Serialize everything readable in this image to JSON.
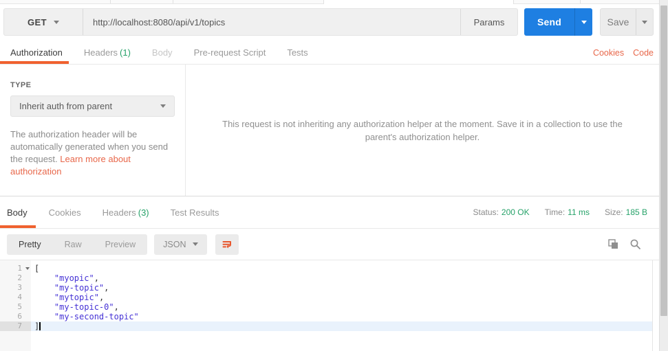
{
  "request": {
    "method": "GET",
    "url": "http://localhost:8080/api/v1/topics",
    "params_label": "Params",
    "send_label": "Send",
    "save_label": "Save",
    "tabs": [
      {
        "label": "Authorization"
      },
      {
        "label": "Headers",
        "count": "(1)"
      },
      {
        "label": "Body"
      },
      {
        "label": "Pre-request Script"
      },
      {
        "label": "Tests"
      }
    ],
    "cookies_link": "Cookies",
    "code_link": "Code"
  },
  "authorization": {
    "type_label": "TYPE",
    "type_value": "Inherit auth from parent",
    "help_text": "The authorization header will be automatically generated when you send the request. ",
    "help_link_label": "Learn more about authorization",
    "inherit_message": "This request is not inheriting any authorization helper at the moment. Save it in a collection to use the parent's authorization helper."
  },
  "response": {
    "tabs": [
      {
        "label": "Body"
      },
      {
        "label": "Cookies"
      },
      {
        "label": "Headers",
        "count": "(3)"
      },
      {
        "label": "Test Results"
      }
    ],
    "meta": {
      "status_label": "Status:",
      "status_value": "200 OK",
      "time_label": "Time:",
      "time_value": "11 ms",
      "size_label": "Size:",
      "size_value": "185 B"
    },
    "toolbar": {
      "modes": [
        {
          "label": "Pretty"
        },
        {
          "label": "Raw"
        },
        {
          "label": "Preview"
        }
      ],
      "format_value": "JSON"
    },
    "body_lines": [
      {
        "num": "1",
        "indent": "",
        "str": "",
        "punct": "["
      },
      {
        "num": "2",
        "indent": "    ",
        "str": "\"myopic\"",
        "punct": ","
      },
      {
        "num": "3",
        "indent": "    ",
        "str": "\"my-topic\"",
        "punct": ","
      },
      {
        "num": "4",
        "indent": "    ",
        "str": "\"mytopic\"",
        "punct": ","
      },
      {
        "num": "5",
        "indent": "    ",
        "str": "\"my-topic-0\"",
        "punct": ","
      },
      {
        "num": "6",
        "indent": "    ",
        "str": "\"my-second-topic\"",
        "punct": ""
      },
      {
        "num": "7",
        "indent": "",
        "str": "",
        "punct": "]"
      }
    ]
  },
  "colors": {
    "accent_orange": "#f0612f",
    "link_orange": "#e8674a",
    "success_green": "#26a269",
    "send_blue": "#1e7fe2",
    "json_string": "#4431d5"
  }
}
